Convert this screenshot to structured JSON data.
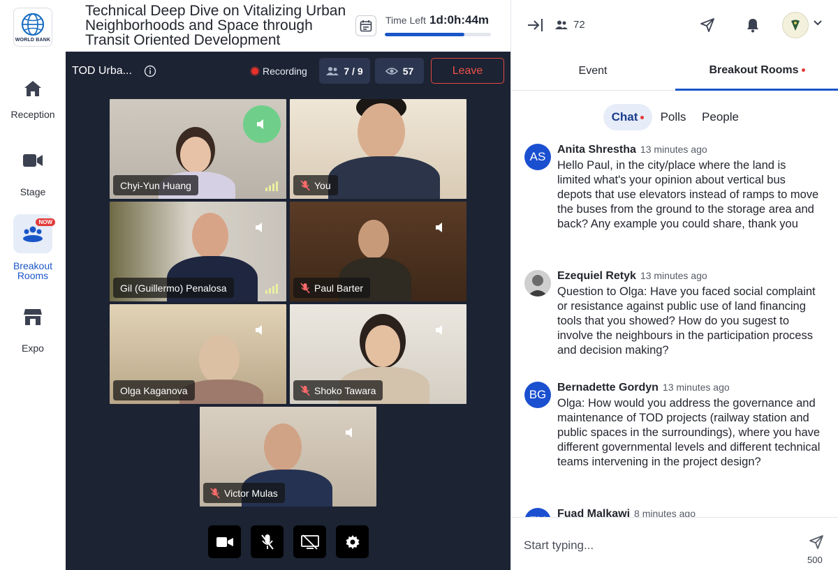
{
  "nav": {
    "logo_text": "WORLD BANK",
    "items": [
      {
        "label": "Reception",
        "icon": "home-icon"
      },
      {
        "label": "Stage",
        "icon": "video-camera-icon"
      },
      {
        "label": "Breakout Rooms",
        "icon": "group-icon",
        "badge": "NOW",
        "active": true
      },
      {
        "label": "Expo",
        "icon": "storefront-icon"
      }
    ]
  },
  "header": {
    "title": "Technical Deep Dive on Vitalizing Urban Neighborhoods and Space through Transit Oriented Development",
    "time_left_label": "Time Left",
    "time_left_value": "1d:0h:44m",
    "time_progress": 0.75
  },
  "stage": {
    "room_name": "TOD Urba...",
    "recording_label": "Recording",
    "participants": "7 / 9",
    "viewers": "57",
    "leave_label": "Leave",
    "tiles": [
      {
        "name": "Chyi-Yun Huang",
        "muted": false,
        "talking": true,
        "signal": true
      },
      {
        "name": "You",
        "muted": true
      },
      {
        "name": "Gil (Guillermo) Penalosa",
        "muted": false,
        "signal": true
      },
      {
        "name": "Paul Barter",
        "muted": true
      },
      {
        "name": "Olga Kaganova",
        "muted": false
      },
      {
        "name": "Shoko Tawara",
        "muted": true
      },
      {
        "name": "Victor Mulas",
        "muted": true
      }
    ]
  },
  "panel": {
    "attendee_count": "72",
    "tabs": [
      {
        "label": "Event"
      },
      {
        "label": "Breakout Rooms",
        "active": true,
        "dot": true
      }
    ],
    "subtabs": [
      {
        "label": "Chat",
        "active": true,
        "dot": true
      },
      {
        "label": "Polls"
      },
      {
        "label": "People"
      }
    ],
    "messages": [
      {
        "initials": "AS",
        "name": "Anita Shrestha",
        "time": "13 minutes ago",
        "text": "Hello Paul, in the city/place where the land is limited what's your opinion about vertical bus depots that use elevators instead of ramps to move the buses from the ground to the storage area and back? Any example you could share, thank you"
      },
      {
        "initials": "",
        "name": "Ezequiel Retyk",
        "time": "13 minutes ago",
        "text": "Question to Olga: Have you faced social complaint or resistance against public use of land financing tools that you showed? How do you sugest to involve the neighbours in the participation process and decision making?"
      },
      {
        "initials": "BG",
        "name": "Bernadette Gordyn",
        "time": "13 minutes ago",
        "text": "Olga: How would you address the governance and maintenance of TOD projects (railway station and public spaces in the surroundings), where you have different governmental levels and different technical teams intervening in the project design?"
      },
      {
        "initials": "FM",
        "name": "Fuad Malkawi",
        "time": "8 minutes ago",
        "text": ""
      }
    ],
    "composer": {
      "placeholder": "Start typing...",
      "char_limit": "500"
    }
  },
  "colors": {
    "accent": "#1a56c8",
    "stage_bg": "#1c2333",
    "leave": "#e44a43",
    "talking": "#6fcf8a"
  }
}
